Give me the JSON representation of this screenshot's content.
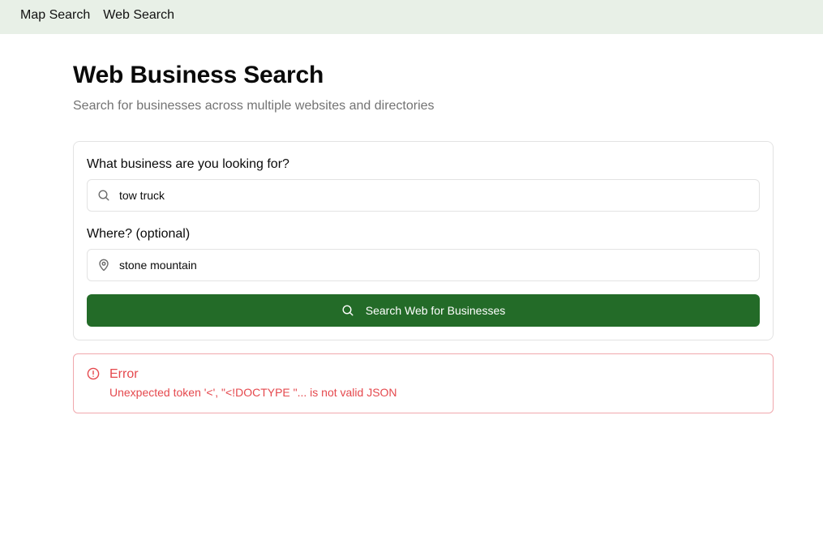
{
  "nav": {
    "links": [
      {
        "label": "Map Search"
      },
      {
        "label": "Web Search"
      }
    ]
  },
  "page": {
    "title": "Web Business Search",
    "subtitle": "Search for businesses across multiple websites and directories"
  },
  "form": {
    "business_label": "What business are you looking for?",
    "business_value": "tow truck",
    "business_icon": "search-icon",
    "location_label": "Where? (optional)",
    "location_value": "stone mountain",
    "location_icon": "map-pin-icon",
    "submit_label": "Search Web for Businesses",
    "submit_icon": "search-icon"
  },
  "error": {
    "icon": "alert-circle-icon",
    "title": "Error",
    "message": "Unexpected token '<', \"<!DOCTYPE \"... is not valid JSON"
  },
  "colors": {
    "nav_background": "#e8f0e7",
    "primary_button": "#236b28",
    "error": "#e5484d",
    "error_border": "#f0a8ad",
    "muted_text": "#737373"
  }
}
